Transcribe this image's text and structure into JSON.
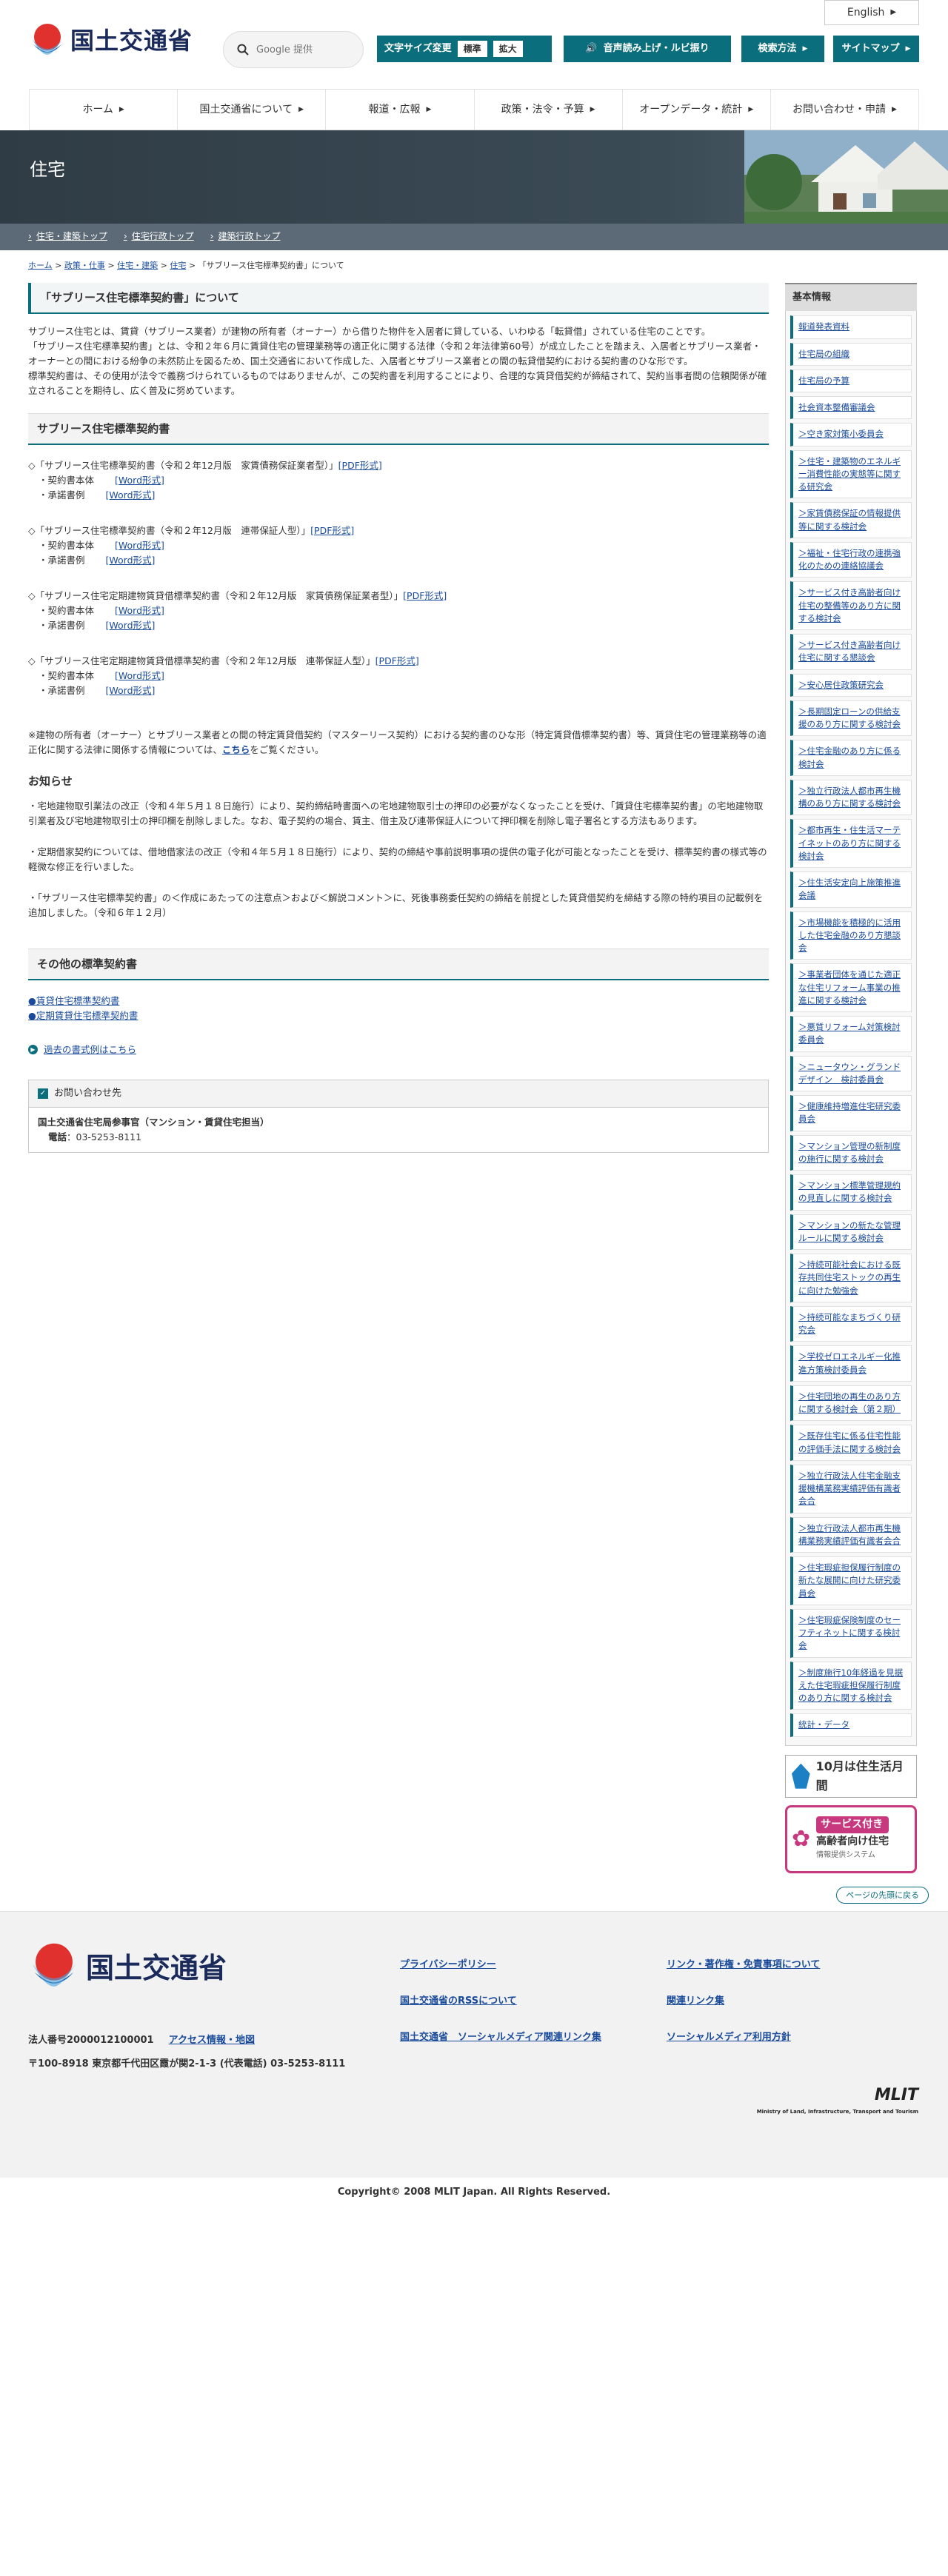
{
  "header": {
    "lang": "English",
    "logo": "国土交通省",
    "search_placeholder": "Google 提供",
    "fontsize_label": "文字サイズ変更",
    "fontsize_std": "標準",
    "fontsize_large": "拡大",
    "voice": "音声読み上げ・ルビ振り",
    "search_method": "検索方法",
    "sitemap": "サイトマップ"
  },
  "nav": [
    "ホーム",
    "国土交通省について",
    "報道・広報",
    "政策・法令・予算",
    "オープンデータ・統計",
    "お問い合わせ・申請"
  ],
  "banner": {
    "title": "住宅",
    "links": [
      "住宅・建築トップ",
      "住宅行政トップ",
      "建築行政トップ"
    ]
  },
  "breadcrumb": [
    "ホーム",
    "政策・仕事",
    "住宅・建築",
    "住宅",
    "「サブリース住宅標準契約書」について"
  ],
  "page_title": "「サブリース住宅標準契約書」について",
  "intro": [
    "サブリース住宅とは、賃貸（サブリース業者）が建物の所有者（オーナー）から借りた物件を入居者に貸している、いわゆる「転貸借」されている住宅のことです。",
    "「サブリース住宅標準契約書」とは、令和２年６月に賃貸住宅の管理業務等の適正化に関する法律（令和２年法律第60号）が成立したことを踏まえ、入居者とサブリース業者・オーナーとの間における紛争の未然防止を図るため、国土交通省において作成した、入居者とサブリース業者との間の転貸借契約における契約書のひな形です。",
    "標準契約書は、その使用が法令で義務づけられているものではありませんが、この契約書を利用することにより、合理的な賃貸借契約が締結されて、契約当事者間の信頼関係が確立されることを期待し、広く普及に努めています。"
  ],
  "section1": "サブリース住宅標準契約書",
  "docs": [
    {
      "title": "◇「サブリース住宅標準契約書（令和２年12月版　家賃債務保証業者型）」",
      "pdf": "[PDF形式]",
      "body": "・契約書本体",
      "example": "・承諾書例",
      "word": "[Word形式]"
    },
    {
      "title": "◇「サブリース住宅標準契約書（令和２年12月版　連帯保証人型）」",
      "pdf": "[PDF形式]",
      "body": "・契約書本体",
      "example": "・承諾書例",
      "word": "[Word形式]"
    },
    {
      "title": "◇「サブリース住宅定期建物賃貸借標準契約書（令和２年12月版　家賃債務保証業者型）」",
      "pdf": "[PDF形式]",
      "body": "・契約書本体",
      "example": "・承諾書例",
      "word": "[Word形式]"
    },
    {
      "title": "◇「サブリース住宅定期建物賃貸借標準契約書（令和２年12月版　連帯保証人型）」",
      "pdf": "[PDF形式]",
      "body": "・契約書本体",
      "example": "・承諾書例",
      "word": "[Word形式]"
    }
  ],
  "master_note": "※建物の所有者（オーナー）とサブリース業者との間の特定賃貸借契約（マスターリース契約）における契約書のひな形（特定賃貸借標準契約書）等、賃貸住宅の管理業務等の適正化に関する法律に関係する情報については、",
  "master_link": "こちら",
  "master_note_end": "をご覧ください。",
  "notice_title": "お知らせ",
  "notices": [
    "・宅地建物取引業法の改正（令和４年５月１８日施行）により、契約締結時書面への宅地建物取引士の押印の必要がなくなったことを受け、「賃貸住宅標準契約書」の宅地建物取引業者及び宅地建物取引士の押印欄を削除しました。なお、電子契約の場合、賃主、借主及び連帯保証人について押印欄を削除し電子署名とする方法もあります。",
    "・定期借家契約については、借地借家法の改正（令和４年５月１８日施行）により、契約の締結や事前説明事項の提供の電子化が可能となったことを受け、標準契約書の様式等の軽微な修正を行いました。",
    "・「サブリース住宅標準契約書」の＜作成にあたっての注意点＞および＜解説コメント＞に、死後事務委任契約の締結を前提とした賃貸借契約を締結する際の特約項目の記載例を追加しました。（令和６年１２月）"
  ],
  "section2": "その他の標準契約書",
  "others": [
    "●賃貸住宅標準契約書",
    "●定期賃貸住宅標準契約書"
  ],
  "past_link": "過去の書式例はこちら",
  "contact": {
    "title": "お問い合わせ先",
    "org": "国土交通省住宅局参事官（マンション・賃貸住宅担当）",
    "tel_label": "電話",
    "tel": "：03-5253-8111"
  },
  "sidebar": {
    "title": "基本情報",
    "items": [
      "報道発表資料",
      "住宅局の組織",
      "住宅局の予算",
      "社会資本整備審議会",
      "＞空き家対策小委員会",
      "＞住宅・建築物のエネルギー消費性能の実態等に関する研究会",
      "＞家賃債務保証の情報提供等に関する検討会",
      "＞福祉・住宅行政の連携強化のための連絡協議会",
      "＞サービス付き高齢者向け住宅の整備等のあり方に関する検討会",
      "＞サービス付き高齢者向け住宅に関する懇談会",
      "＞安心居住政策研究会",
      "＞長期固定ローンの供給支援のあり方に関する検討会",
      "＞住宅金融のあり方に係る検討会",
      "＞独立行政法人都市再生機構のあり方に関する検討会",
      "＞都市再生・住生活マーテイネットのあり方に関する検討会",
      "＞住生活安定向上施策推進会議",
      "＞市場機能を積極的に活用した住宅金融のあり方懇談会",
      "＞事業者団体を通じた適正な住宅リフォーム事業の推進に関する検討会",
      "＞悪質リフォーム対策検討委員会",
      "＞ニュータウン・グランドデザイン　検討委員会",
      "＞健康維持増進住宅研究委員会",
      "＞マンション管理の新制度の施行に関する検討会",
      "＞マンション標準管理規約の見直しに関する検討会",
      "＞マンションの新たな管理ルールに関する検討会",
      "＞持続可能社会における既存共同住宅ストックの再生に向けた勉強会",
      "＞持続可能なまちづくり研究会",
      "＞学校ゼロエネルギー化推進方策検討委員会",
      "＞住宅団地の再生のあり方に関する検討会（第２期）",
      "＞既存住宅に係る住宅性能の評価手法に関する検討会",
      "＞独立行政法人住宅金融支援機構業務実績評価有識者会合",
      "＞独立行政法人都市再生機構業務実績評価有識者会合",
      "＞住宅瑕疵担保履行制度の新たな展開に向けた研究委員会",
      "＞住宅瑕疵保険制度のセーフティネットに関する検討会",
      "＞制度施行10年経過を見据えた住宅瑕疵担保履行制度のあり方に関する検討会",
      "統計・データ"
    ],
    "banner1": "10月は住生活月間",
    "banner2_title": "サービス付き",
    "banner2_sub": "高齢者向け住宅",
    "banner2_note": "情報提供システム"
  },
  "totop": "ページの先頭に戻る",
  "footer": {
    "logo": "国土交通省",
    "links": [
      "プライバシーポリシー",
      "リンク・著作権・免責事項について",
      "国土交通省のRSSについて",
      "関連リンク集",
      "国土交通省　ソーシャルメディア関連リンク集",
      "ソーシャルメディア利用方針"
    ],
    "corp_no": "法人番号2000012100001",
    "access": "アクセス情報・地図",
    "address": "〒100-8918 東京都千代田区霞が関2-1-3 (代表電話) 03-5253-8111",
    "mlit": "MLIT",
    "mlit_sub": "Ministry of Land, Infrastructure, Transport and Tourism",
    "copyright": "Copyright© 2008 MLIT Japan. All Rights Reserved."
  },
  "colors": {
    "accent": "#0b6e7c",
    "link": "#1a4b9b",
    "banner": "#2f3c45"
  }
}
